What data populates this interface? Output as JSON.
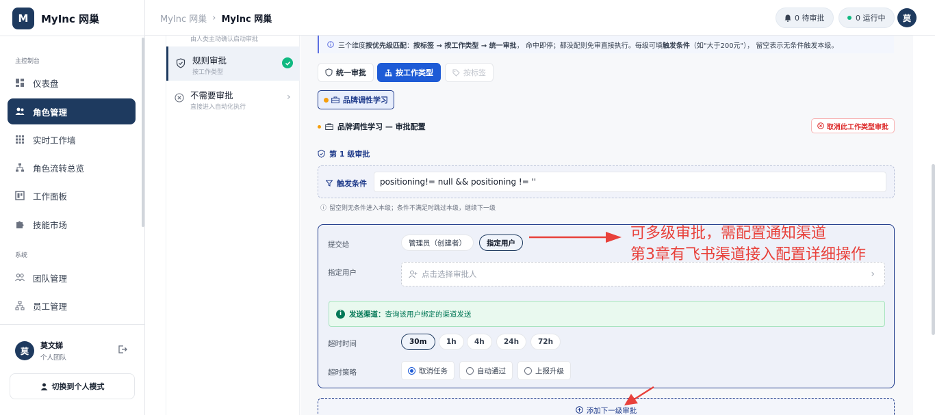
{
  "brand": {
    "logo_letter": "M",
    "name": "MyInc 网巢"
  },
  "sidebar": {
    "section_main": "主控制台",
    "section_system": "系统",
    "items": [
      {
        "label": "仪表盘",
        "icon": "dashboard-icon"
      },
      {
        "label": "角色管理",
        "icon": "users-icon",
        "active": true
      },
      {
        "label": "实时工作墙",
        "icon": "grid-icon"
      },
      {
        "label": "角色流转总览",
        "icon": "flow-icon"
      },
      {
        "label": "工作面板",
        "icon": "board-icon"
      },
      {
        "label": "技能市场",
        "icon": "puzzle-icon"
      }
    ],
    "system_items": [
      {
        "label": "团队管理",
        "icon": "team-icon"
      },
      {
        "label": "员工管理",
        "icon": "org-icon"
      }
    ],
    "user": {
      "avatar": "莫",
      "name": "莫文娣",
      "team": "个人团队"
    },
    "switch_label": "切换到个人模式"
  },
  "header": {
    "crumb_parent": "MyInc 网巢",
    "crumb_current": "MyInc 网巢",
    "pending": "0 待审批",
    "running": "0 运行中",
    "avatar": "莫"
  },
  "list": {
    "top_partial": "由人类主动确认启动审批",
    "items": [
      {
        "title": "规则审批",
        "subtitle": "按工作类型",
        "selected": true
      },
      {
        "title": "不需要审批",
        "subtitle": "直接进入自动化执行"
      }
    ]
  },
  "main": {
    "banner_prefix": "三个维度",
    "banner_bold1": "按优先级匹配",
    "banner_mid1": "：",
    "banner_bold2": "按标签 → 按工作类型 → 统一审批",
    "banner_mid2": "，  命中即停；都没配则免审直接执行。每级可填",
    "banner_bold3": "触发条件",
    "banner_suffix": "（如\"大于200元\"），  留空表示无条件触发本级。",
    "tabs": [
      {
        "label": "统一审批",
        "state": "default"
      },
      {
        "label": "按工作类型",
        "state": "active"
      },
      {
        "label": "按标签",
        "state": "disabled"
      }
    ],
    "work_type_tag": "品牌调性学习",
    "config_title": "品牌调性学习 — 审批配置",
    "cancel_label": "取消此工作类型审批",
    "level_title": "第 1 级审批",
    "trigger_label": "触发条件",
    "trigger_value": "positioning!= null && positioning != ''",
    "hint": "留空则无条件进入本级；条件不满足时跳过本级，继续下一级",
    "submit_label": "提交给",
    "submit_options": [
      "管理员（创建者）",
      "指定用户"
    ],
    "submit_selected": "指定用户",
    "assign_label": "指定用户",
    "assign_placeholder": "点击选择审批人",
    "channel_title": "发送渠道：",
    "channel_text": "查询该用户绑定的渠道发送",
    "timeout_label": "超时时间",
    "timeout_options": [
      "30m",
      "1h",
      "4h",
      "24h",
      "72h"
    ],
    "timeout_selected": "30m",
    "strategy_label": "超时策略",
    "strategy_options": [
      "取消任务",
      "自动通过",
      "上报升级"
    ],
    "strategy_selected": "取消任务",
    "add_level": "添加下一级审批"
  },
  "annotation": {
    "line1": "可多级审批，需配置通知渠道",
    "line2": "第3章有飞书渠道接入配置详细操作",
    "color": "#e8413b"
  }
}
